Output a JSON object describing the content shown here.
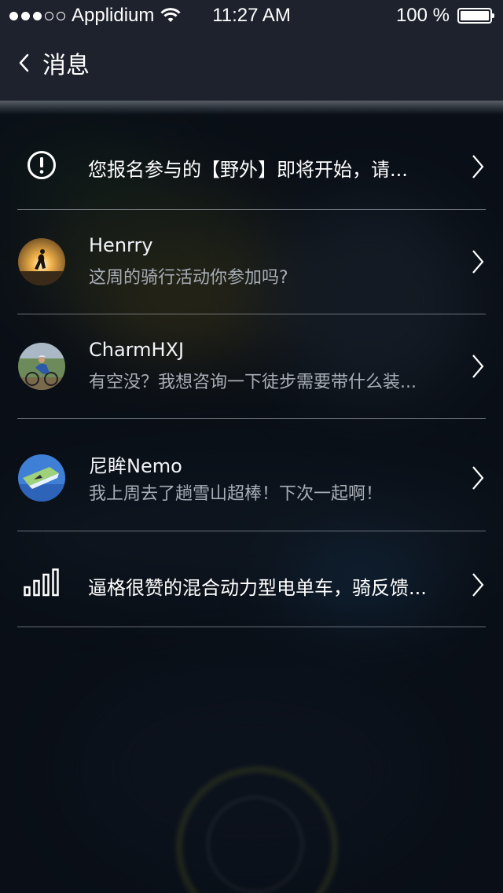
{
  "status_bar": {
    "carrier": "Applidium",
    "time": "11:27 AM",
    "battery": "100 %"
  },
  "nav": {
    "title": "消息"
  },
  "messages": [
    {
      "type": "notice",
      "icon": "alert-icon",
      "text": "您报名参与的【野外】即将开始，请..."
    },
    {
      "type": "chat",
      "name": "Henrry",
      "text": "这周的骑行活动你参加吗?"
    },
    {
      "type": "chat",
      "name": "CharmHXJ",
      "text": "有空没？我想咨询一下徒步需要带什么装..."
    },
    {
      "type": "chat",
      "name": "尼眸Nemo",
      "text": "我上周去了趟雪山超棒！下次一起啊！"
    },
    {
      "type": "notice",
      "icon": "bar-chart-icon",
      "text": "逼格很赞的混合动力型电单车，骑反馈..."
    }
  ],
  "colors": {
    "bar_background": "#1d222c",
    "secondary_text": "#a8adb6"
  }
}
